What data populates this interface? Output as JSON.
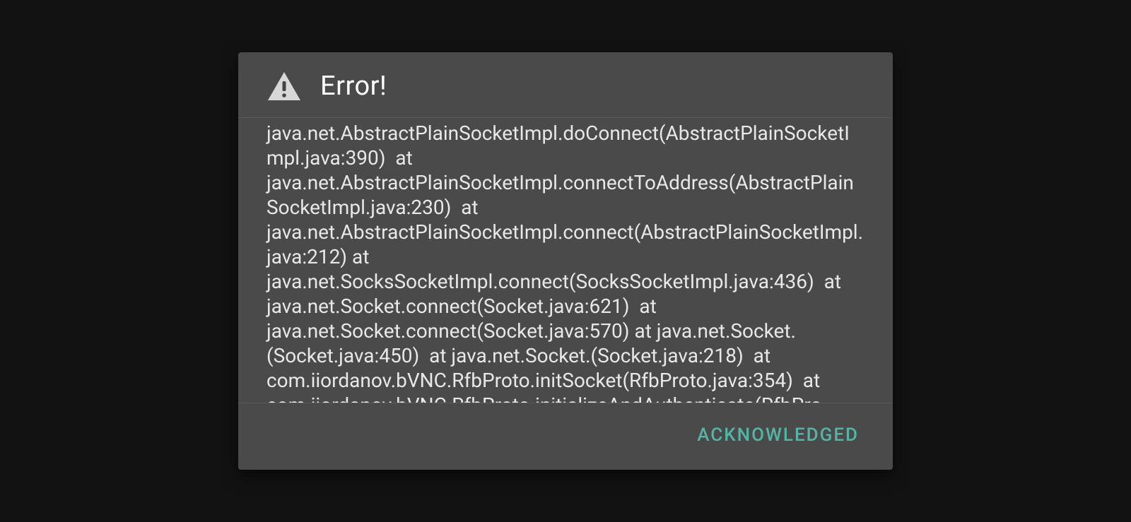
{
  "dialog": {
    "title": "Error!",
    "body": "java.net.AbstractPlainSocketImpl.doConnect(AbstractPlainSocketImpl.java:390)  at java.net.AbstractPlainSocketImpl.connectToAddress(AbstractPlainSocketImpl.java:230)  at java.net.AbstractPlainSocketImpl.connect(AbstractPlainSocketImpl.java:212) at java.net.SocksSocketImpl.connect(SocksSocketImpl.java:436)  at java.net.Socket.connect(Socket.java:621)  at java.net.Socket.connect(Socket.java:570) at java.net.Socket.(Socket.java:450)  at java.net.Socket.(Socket.java:218)  at com.iiordanov.bVNC.RfbProto.initSocket(RfbProto.java:354)  at com.iiordanov.bVNC.RfbProto.initializeAndAuthenticate(RfbPro",
    "ack_label": "ACKNOWLEDGED"
  }
}
